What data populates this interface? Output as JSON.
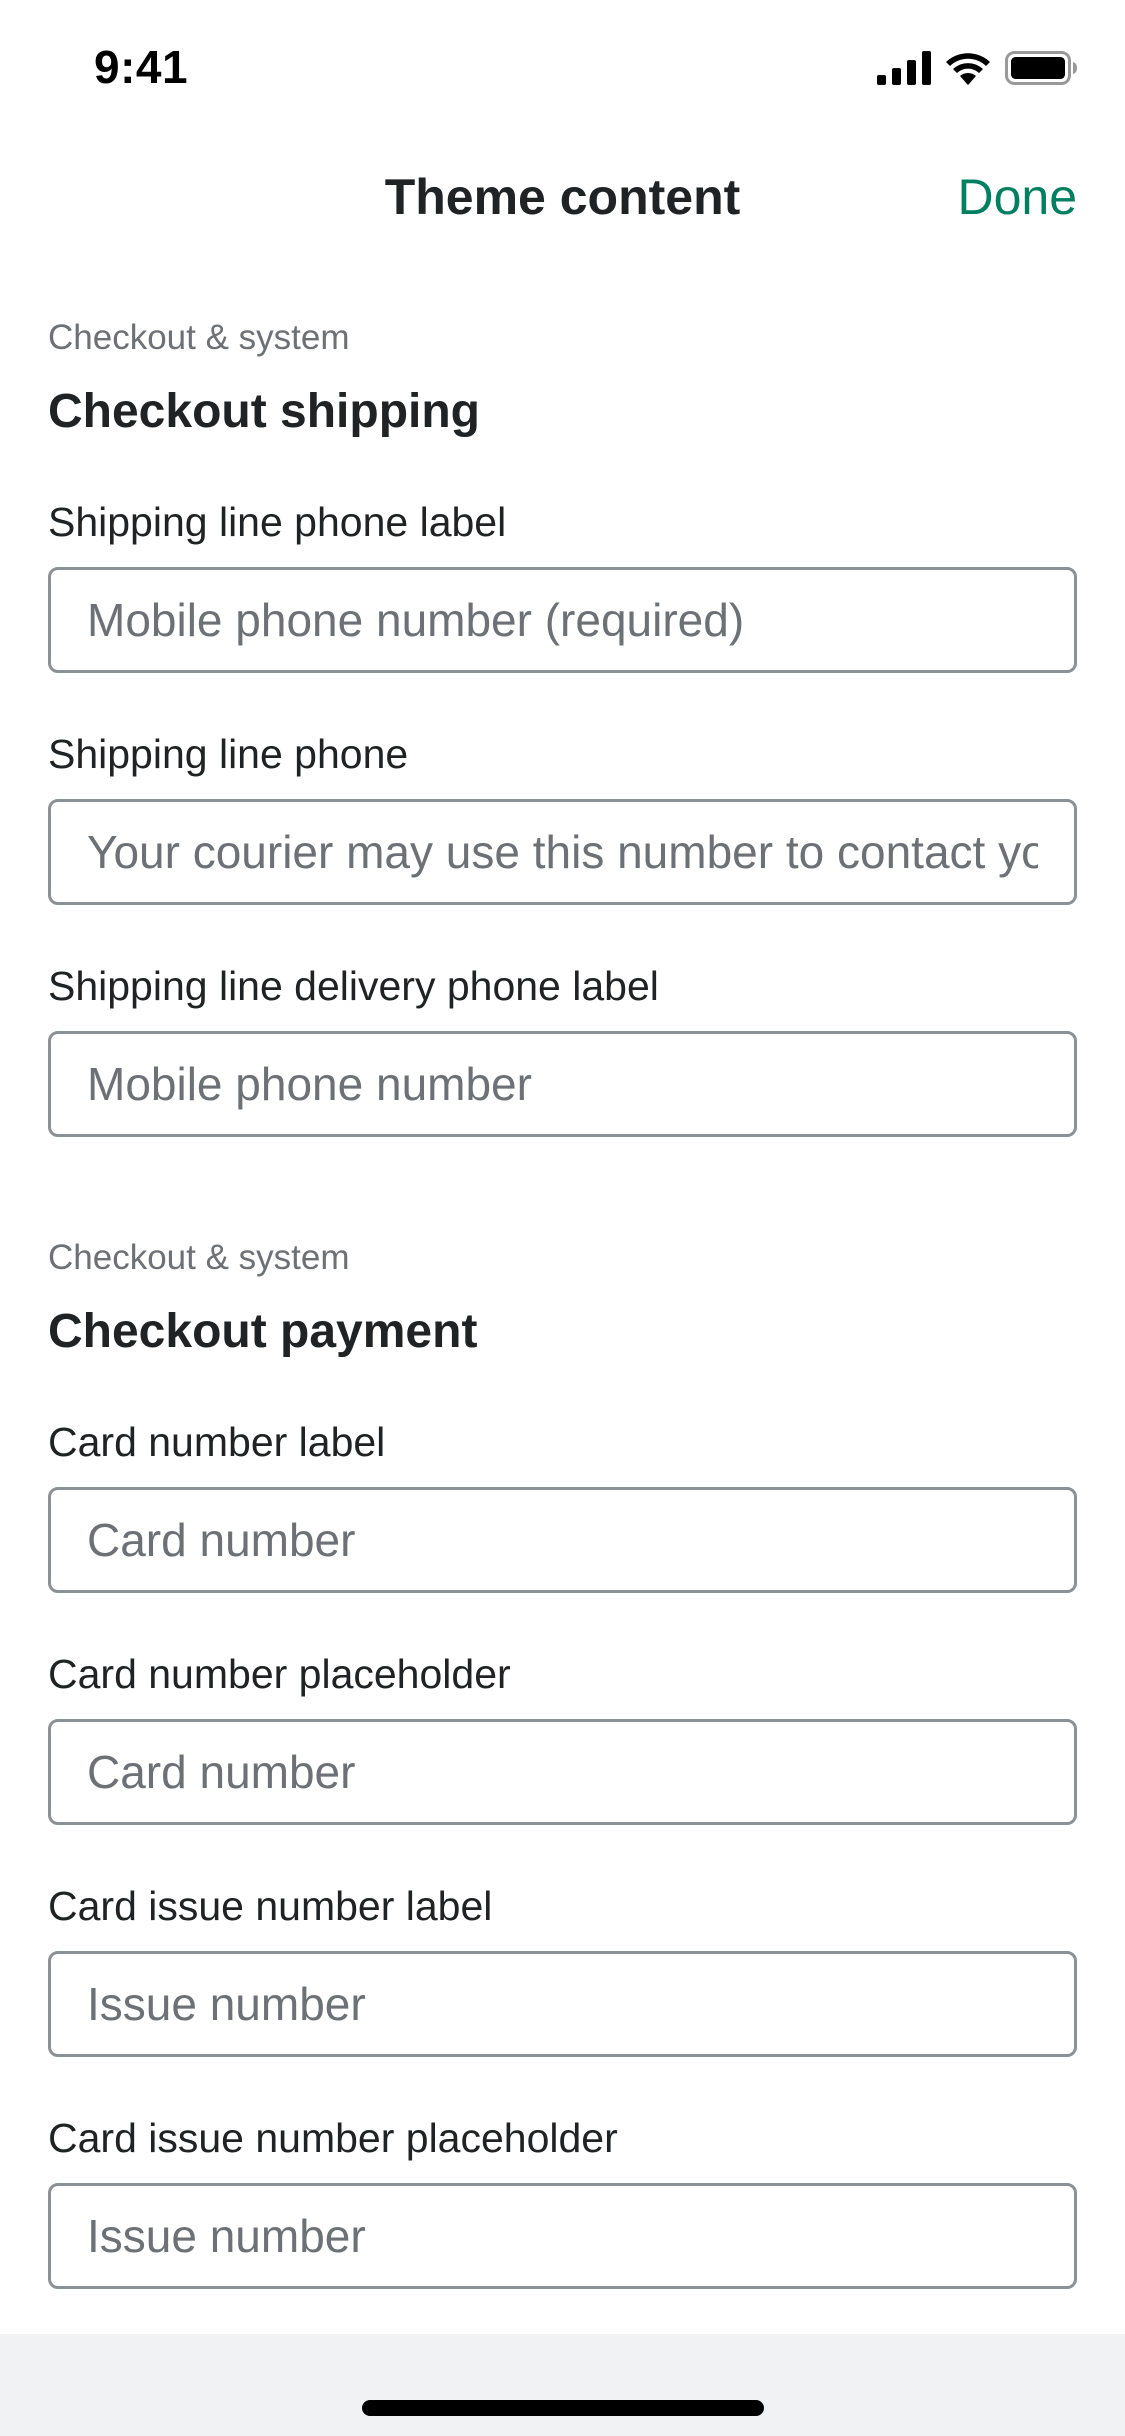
{
  "status_bar": {
    "time": "9:41",
    "icons": [
      "cellular-signal-icon",
      "wifi-icon",
      "battery-icon"
    ]
  },
  "nav": {
    "title": "Theme content",
    "done_label": "Done",
    "accent_color": "#008060"
  },
  "sections": [
    {
      "caption": "Checkout & system",
      "title": "Checkout shipping",
      "fields": [
        {
          "label": "Shipping line phone label",
          "placeholder": "Mobile phone number (required)"
        },
        {
          "label": "Shipping line phone",
          "placeholder": "Your courier may use this number to contact you"
        },
        {
          "label": "Shipping line delivery phone label",
          "placeholder": "Mobile phone number"
        }
      ]
    },
    {
      "caption": "Checkout & system",
      "title": "Checkout payment",
      "fields": [
        {
          "label": "Card number label",
          "placeholder": "Card number"
        },
        {
          "label": "Card number placeholder",
          "placeholder": "Card number"
        },
        {
          "label": "Card issue number label",
          "placeholder": "Issue number"
        },
        {
          "label": "Card issue number placeholder",
          "placeholder": "Issue number"
        }
      ]
    }
  ]
}
